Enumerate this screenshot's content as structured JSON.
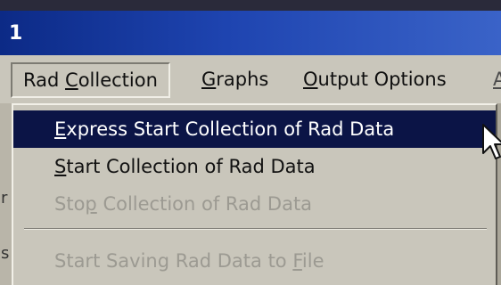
{
  "window": {
    "title": "1"
  },
  "menubar": {
    "items": [
      {
        "pre": "Rad ",
        "ul": "C",
        "post": "ollection"
      },
      {
        "pre": "",
        "ul": "G",
        "post": "raphs"
      },
      {
        "pre": "",
        "ul": "O",
        "post": "utput Options"
      }
    ],
    "extra_partial": "A"
  },
  "dropdown": {
    "items": [
      {
        "pre": "",
        "ul": "E",
        "post": "xpress Start Collection of Rad Data",
        "state": "highlighted"
      },
      {
        "pre": "",
        "ul": "S",
        "post": "tart Collection of Rad Data",
        "state": "enabled"
      },
      {
        "pre": "Sto",
        "ul": "p",
        "post": " Collection of Rad Data",
        "state": "disabled"
      },
      {
        "pre": "Start Saving Rad Data to ",
        "ul": "F",
        "post": "ile",
        "state": "disabled"
      }
    ]
  },
  "left_edge": {
    "chars": [
      "r",
      "s"
    ]
  },
  "colors": {
    "titlebar": "#1e44b0",
    "menu_bg": "#c9c6bb",
    "highlight": "#0b1446",
    "disabled_text": "#9c9a92"
  },
  "icons": {
    "cursor": "arrow-pointer-icon"
  }
}
